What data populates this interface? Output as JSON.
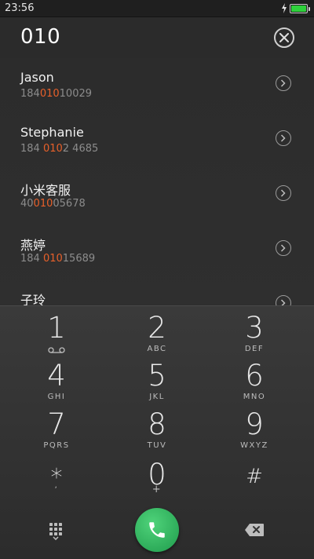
{
  "status_bar": {
    "time": "23:56",
    "icons": [
      "charging-bolt-icon",
      "battery-icon"
    ]
  },
  "header": {
    "query": "010",
    "clear_icon": "close-icon"
  },
  "contacts": [
    {
      "name": "Jason",
      "number_pre": "184",
      "number_hl": "010",
      "number_post": "10029"
    },
    {
      "name": "Stephanie",
      "number_pre": "184 ",
      "number_hl": "010",
      "number_post": "2 4685"
    },
    {
      "name": "小米客服",
      "number_pre": "40",
      "number_hl": "010",
      "number_post": "05678"
    },
    {
      "name": "燕婷",
      "number_pre": "184 ",
      "number_hl": "010",
      "number_post": "15689"
    },
    {
      "name": "子玲",
      "number_pre": "",
      "number_hl": "",
      "number_post": ""
    }
  ],
  "keypad": {
    "keys": [
      {
        "digit": "1",
        "letters": ""
      },
      {
        "digit": "2",
        "letters": "ABC"
      },
      {
        "digit": "3",
        "letters": "DEF"
      },
      {
        "digit": "4",
        "letters": "GHI"
      },
      {
        "digit": "5",
        "letters": "JKL"
      },
      {
        "digit": "6",
        "letters": "MNO"
      },
      {
        "digit": "7",
        "letters": "PQRS"
      },
      {
        "digit": "8",
        "letters": "TUV"
      },
      {
        "digit": "9",
        "letters": "WXYZ"
      },
      {
        "digit": "*",
        "letters": ","
      },
      {
        "digit": "0",
        "letters": "+"
      },
      {
        "digit": "#",
        "letters": ""
      }
    ]
  },
  "colors": {
    "highlight": "#e8602a",
    "call_green": "#2bb35c",
    "battery_green": "#2fd13c"
  },
  "bottom_bar": {
    "left_icon": "dialpad-grid-icon",
    "center_icon": "phone-icon",
    "right_icon": "backspace-icon"
  }
}
